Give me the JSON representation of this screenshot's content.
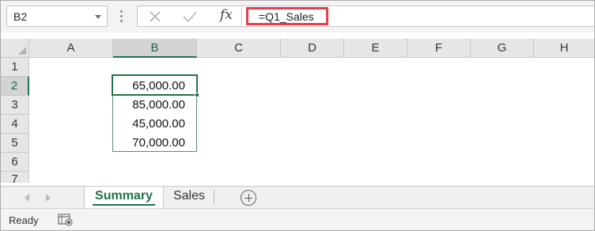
{
  "formula_bar": {
    "name_box": "B2",
    "fx_label": "fx",
    "formula": "=Q1_Sales"
  },
  "grid": {
    "columns": [
      "A",
      "B",
      "C",
      "D",
      "E",
      "F",
      "G",
      "H"
    ],
    "rows": [
      "1",
      "2",
      "3",
      "4",
      "5",
      "6",
      "7"
    ],
    "selected_column": "B",
    "selected_row": "2",
    "cells": {
      "B2": "65,000.00",
      "B3": "85,000.00",
      "B4": "45,000.00",
      "B5": "70,000.00"
    }
  },
  "sheet_tabs": [
    {
      "label": "Summary",
      "active": true
    },
    {
      "label": "Sales",
      "active": false
    }
  ],
  "status_bar": {
    "text": "Ready"
  },
  "colors": {
    "accent": "#217346",
    "highlight_border": "#e0414a"
  }
}
